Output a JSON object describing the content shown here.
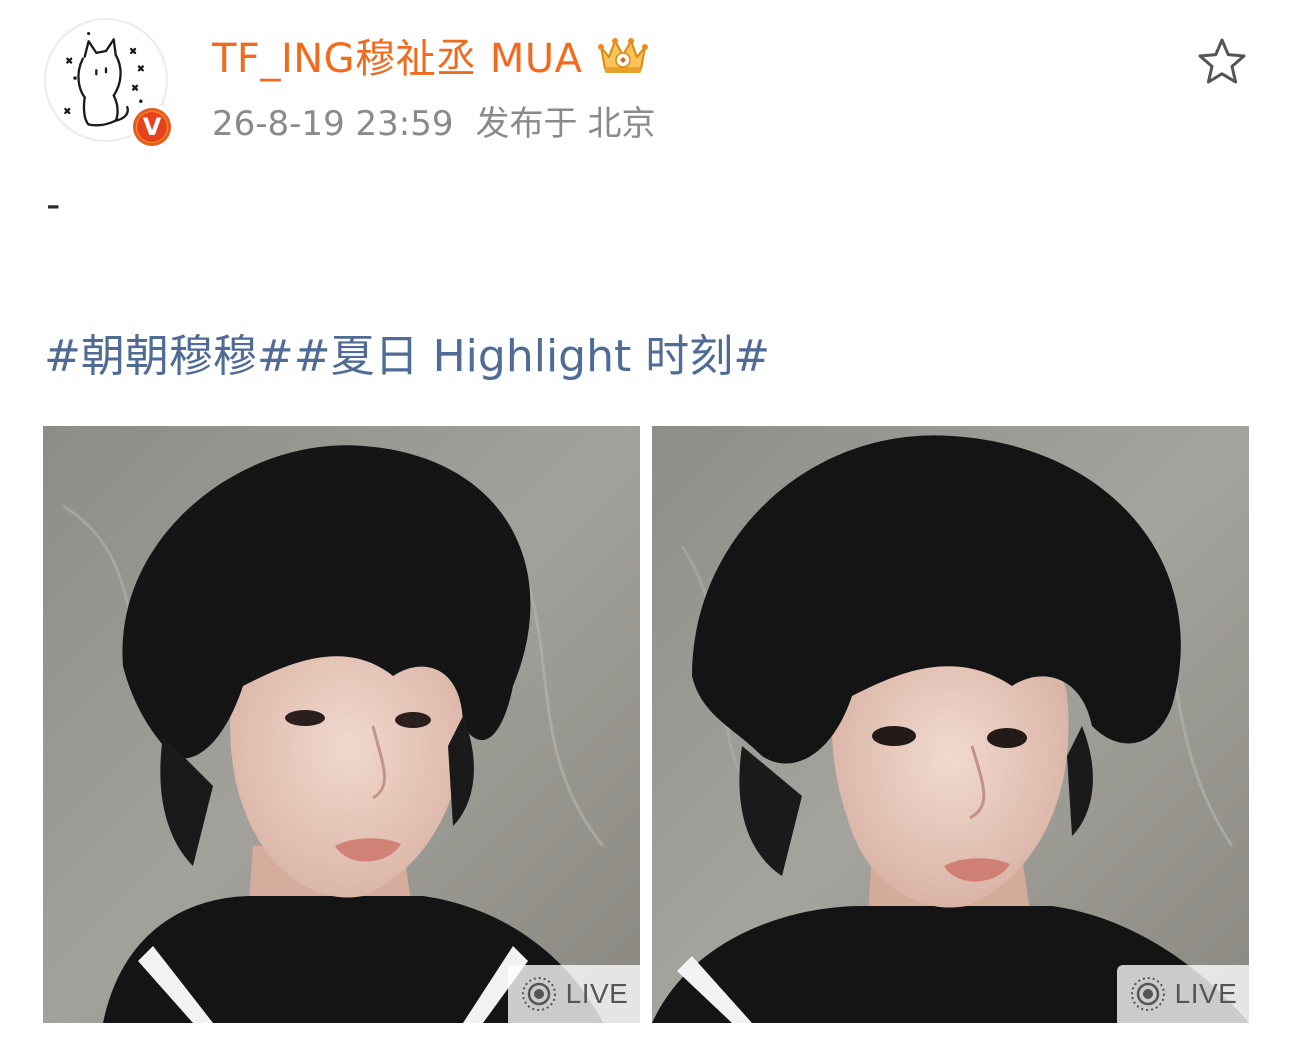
{
  "post": {
    "author": {
      "username": "TF_ING穆祉丞 MUA",
      "avatar_icon": "cat-doodle-avatar",
      "verified_icon": "verified-v-badge",
      "verified_label": "V",
      "member_icon": "crown-badge-icon"
    },
    "meta": {
      "timestamp": "26-8-19 23:59",
      "published_label": "发布于",
      "location": "北京"
    },
    "favorite_icon": "star-outline-icon",
    "body_text": "-",
    "hashtags": [
      "#朝朝穆穆#",
      "#夏日 Highlight 时刻#"
    ],
    "photos": [
      {
        "badge_icon": "live-photo-icon",
        "badge_label": "LIVE"
      },
      {
        "badge_icon": "live-photo-icon",
        "badge_label": "LIVE"
      }
    ]
  },
  "colors": {
    "username": "#f26b1d",
    "meta": "#8a8a8a",
    "hashtag": "#4f6b96",
    "verified": "#f39b1c"
  }
}
